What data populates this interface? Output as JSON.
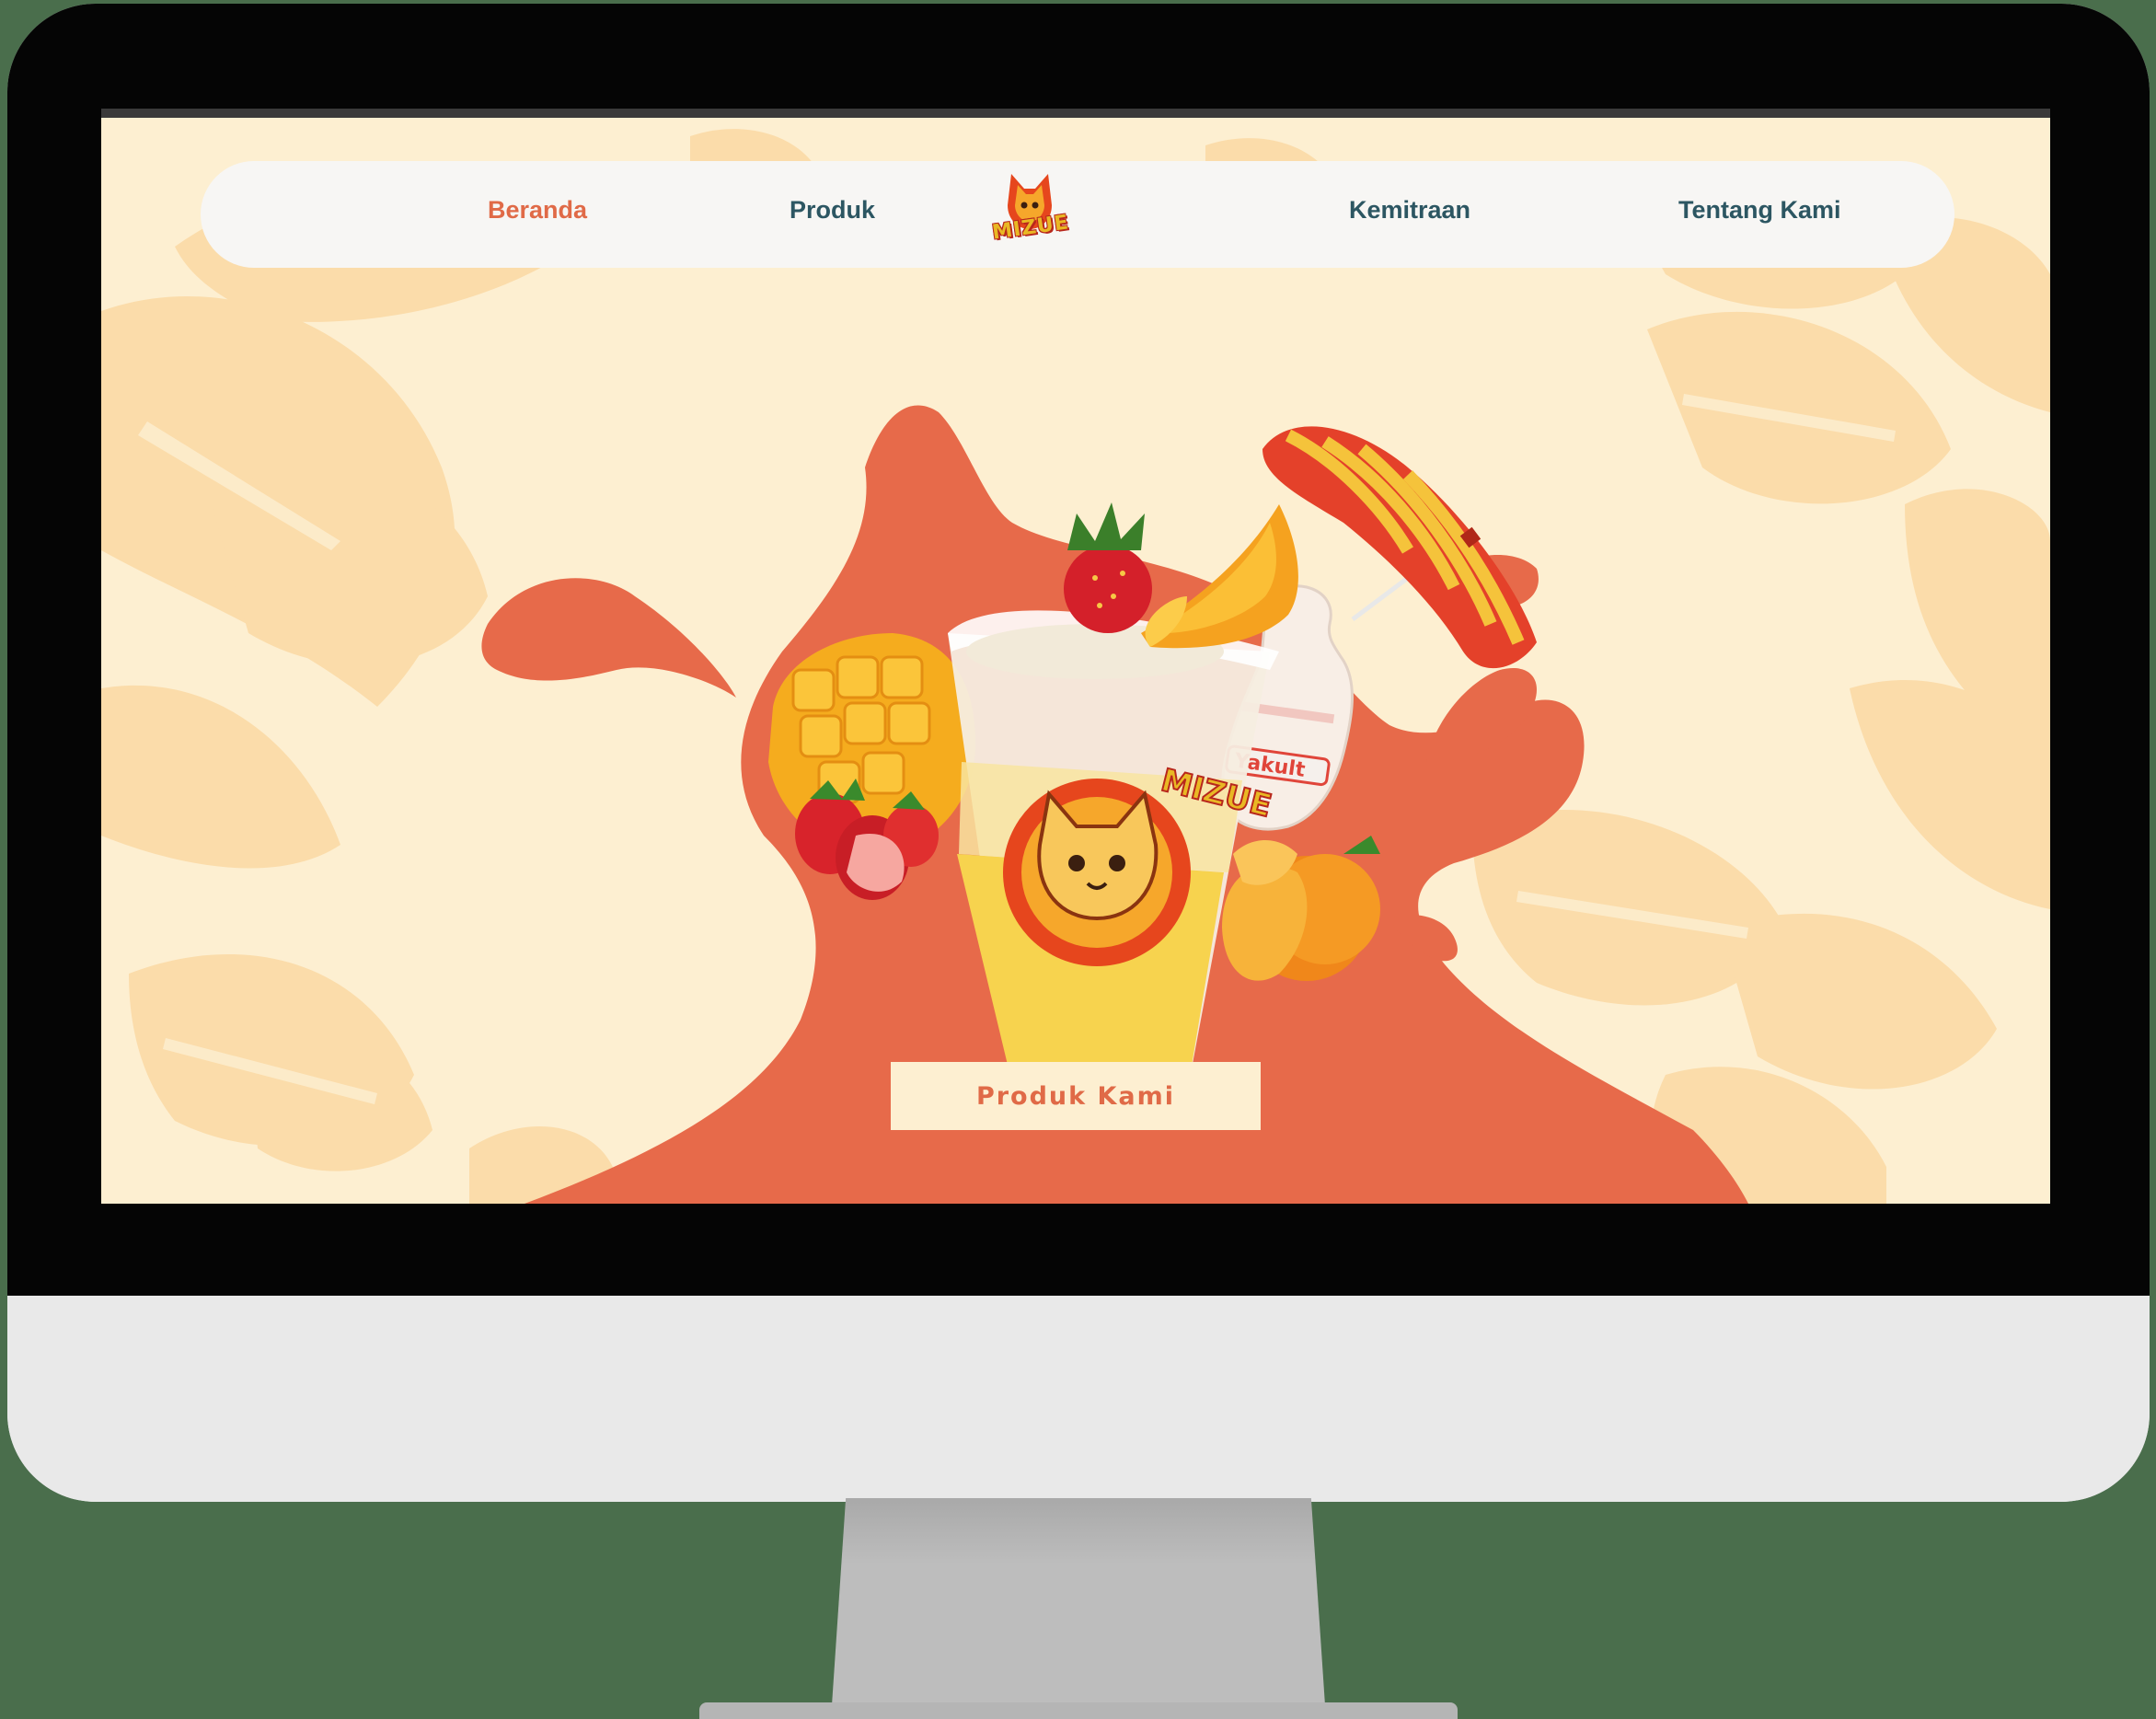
{
  "nav": {
    "items": [
      {
        "label": "Beranda",
        "active": true
      },
      {
        "label": "Produk",
        "active": false
      },
      {
        "label": "Kemitraan",
        "active": false
      },
      {
        "label": "Tentang Kami",
        "active": false
      }
    ],
    "logo_text": "MIZUE"
  },
  "hero": {
    "cta_label": "Produk Kami",
    "cup_brand": "MIZUE",
    "bottle_label": "Yakult"
  },
  "colors": {
    "page_bg": "#fdefd1",
    "leaf": "#fbdcaa",
    "splash": "#e76a4a",
    "accent": "#e06a47",
    "nav_text": "#2c5662",
    "nav_bg": "#f7f6f4"
  },
  "icons": [
    "cat-mascot-icon",
    "leaf-pattern",
    "beach-umbrella",
    "strawberry",
    "orange",
    "mango"
  ]
}
